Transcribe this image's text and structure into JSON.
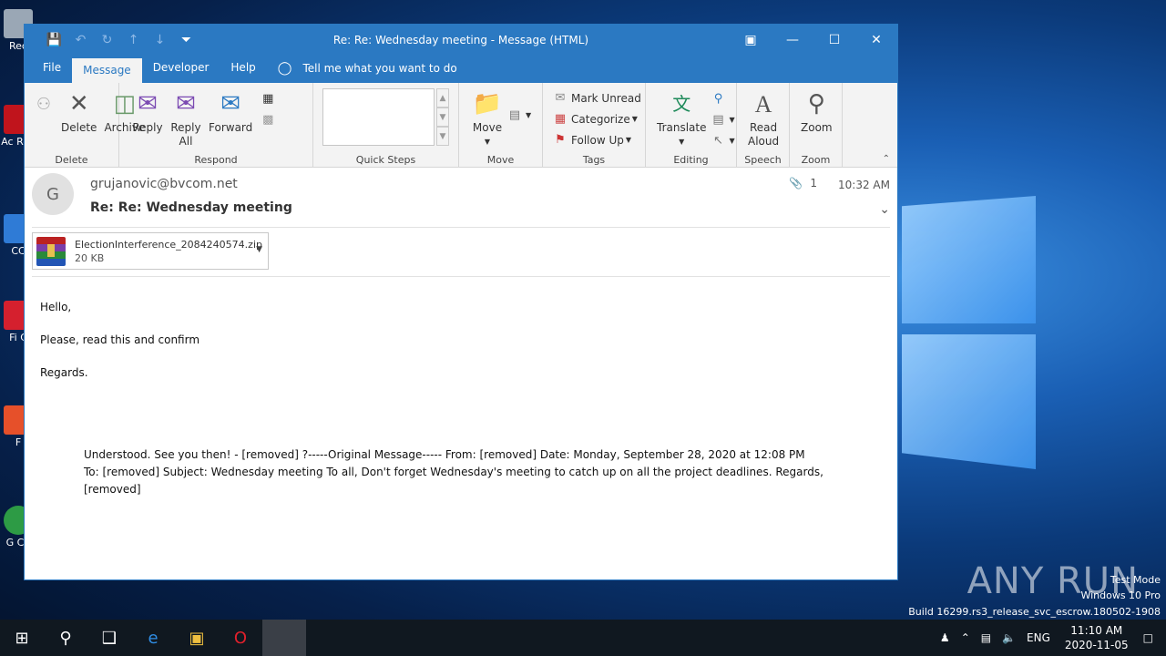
{
  "window": {
    "title": "Re: Re: Wednesday meeting  -  Message (HTML)"
  },
  "tabs": [
    "File",
    "Message",
    "Developer",
    "Help"
  ],
  "tellme": "Tell me what you want to do",
  "ribbon": {
    "delete_group": {
      "label": "Delete",
      "delete": "Delete",
      "archive": "Archive"
    },
    "respond_group": {
      "label": "Respond",
      "reply": "Reply",
      "reply_all_1": "Reply",
      "reply_all_2": "All",
      "forward": "Forward"
    },
    "quicksteps_group": {
      "label": "Quick Steps"
    },
    "move_group": {
      "label": "Move",
      "move": "Move"
    },
    "tags_group": {
      "label": "Tags",
      "mark_unread": "Mark Unread",
      "categorize": "Categorize",
      "follow_up": "Follow Up"
    },
    "editing_group": {
      "label": "Editing",
      "translate": "Translate"
    },
    "speech_group": {
      "label": "Speech",
      "read_1": "Read",
      "read_2": "Aloud"
    },
    "zoom_group": {
      "label": "Zoom",
      "zoom": "Zoom"
    }
  },
  "message": {
    "avatar_letter": "G",
    "from": "grujanovic@bvcom.net",
    "subject": "Re: Re: Wednesday meeting",
    "attachment_count": "1",
    "time": "10:32 AM",
    "attachment": {
      "name": "ElectionInterference_2084240574.zip",
      "size": "20 KB"
    },
    "body": [
      "Hello,",
      "Please, read this and confirm",
      "Regards."
    ],
    "quoted_1": "Understood. See you then! - [removed] ?-----Original Message----- From: [removed] Date: Monday, September 28, 2020  at 12:08 PM",
    "quoted_2": "To: [removed] Subject: Wednesday meeting To all, Don't forget Wednesday's meeting to catch up on all the project deadlines. Regards, [removed]"
  },
  "desktop": {
    "icons": [
      "Rec",
      "Ac Rea",
      "CC",
      "Fi C",
      "F",
      "G Ch"
    ],
    "watermark": "ANY RUN",
    "test_mode": "Test Mode",
    "edition": "Windows 10 Pro",
    "build": "Build 16299.rs3_release_svc_escrow.180502-1908"
  },
  "taskbar": {
    "lang": "ENG",
    "time": "11:10 AM",
    "date": "2020-11-05"
  }
}
